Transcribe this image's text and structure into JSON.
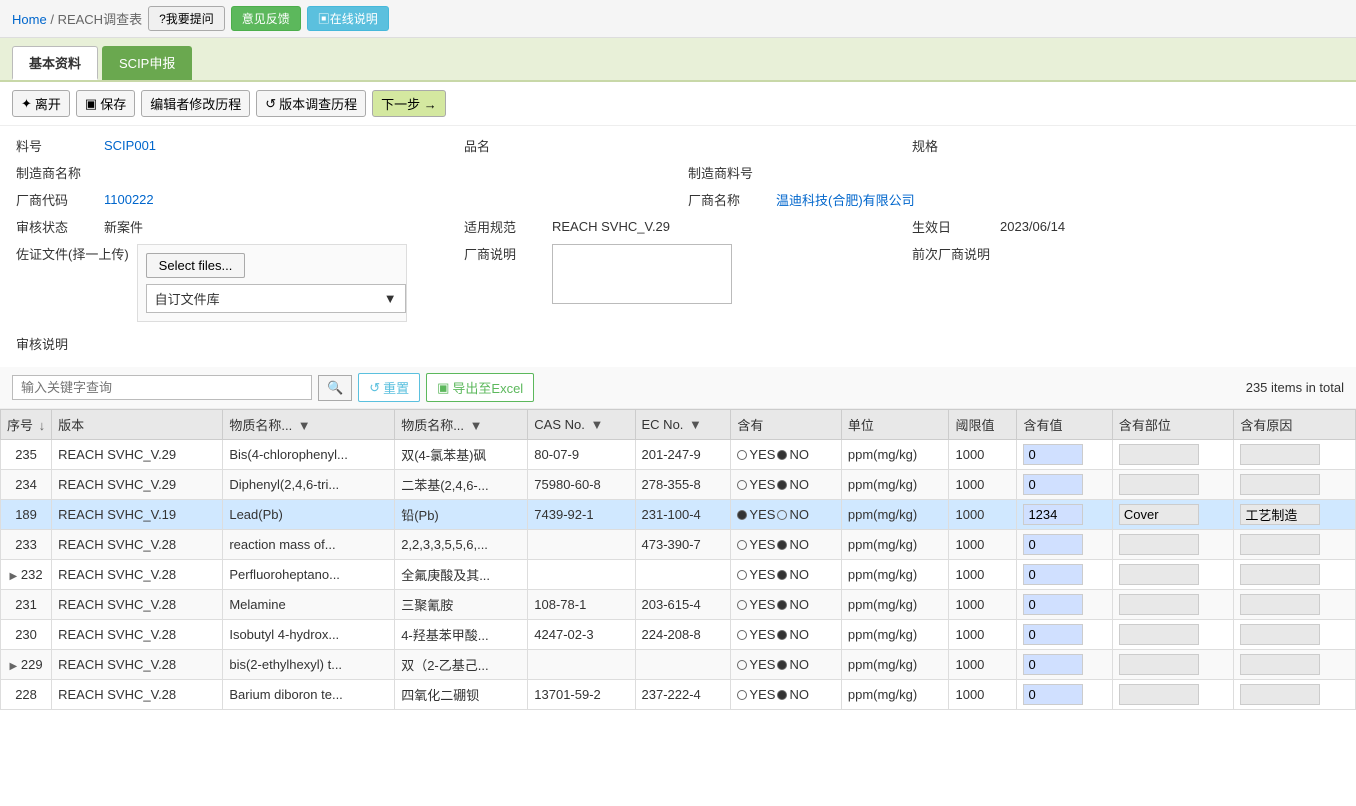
{
  "breadcrumb": {
    "home": "Home",
    "separator": "/",
    "current": "REACH调查表"
  },
  "top_buttons": [
    {
      "label": "?我要提问",
      "type": "default"
    },
    {
      "label": "意见反馈",
      "type": "green"
    },
    {
      "label": "▣在线说明",
      "type": "blue"
    }
  ],
  "tabs": [
    {
      "label": "基本资料",
      "active": true
    },
    {
      "label": "SCIP申报",
      "active": false,
      "style": "scip"
    }
  ],
  "toolbar_buttons": [
    {
      "label": "✦ 离开",
      "icon": "leave-icon"
    },
    {
      "label": "▣ 保存",
      "icon": "save-icon"
    },
    {
      "label": "编辑者修改历程",
      "icon": "edit-history-icon"
    },
    {
      "label": "↺ 版本调查历程",
      "icon": "version-history-icon"
    },
    {
      "label": "下一步 →",
      "icon": "next-icon"
    }
  ],
  "form": {
    "fields": [
      {
        "label": "料号",
        "value": "SCIP001",
        "label2": "品名",
        "value2": "",
        "label3": "规格",
        "value3": ""
      },
      {
        "label": "制造商名称",
        "value": "",
        "label2": "制造商料号",
        "value2": ""
      },
      {
        "label": "厂商代码",
        "value": "1100222",
        "label2": "厂商名称",
        "value2": "温迪科技(合肥)有限公司"
      },
      {
        "label": "审核状态",
        "value": "新案件",
        "label2": "适用规范",
        "value2": "REACH SVHC_V.29",
        "label3": "生效日",
        "value3": "2023/06/14"
      }
    ],
    "file_upload_label": "佐证文件(择一上传)",
    "select_files_btn": "Select files...",
    "file_dropdown_label": "自订文件库",
    "vendor_note_label": "厂商说明",
    "prev_vendor_note_label": "前次厂商说明",
    "review_note_label": "审核说明"
  },
  "search": {
    "placeholder": "输入关键字查询",
    "reset_label": "↺ 重置",
    "export_label": "▣ 导出至Excel",
    "total": "235 items in total"
  },
  "table": {
    "columns": [
      {
        "key": "seq",
        "label": "序号",
        "sortable": true
      },
      {
        "key": "version",
        "label": "版本"
      },
      {
        "key": "substance_en",
        "label": "物质名称...",
        "filterable": true
      },
      {
        "key": "substance_zh",
        "label": "物质名称...",
        "filterable": true
      },
      {
        "key": "cas_no",
        "label": "CAS No.",
        "filterable": true
      },
      {
        "key": "ec_no",
        "label": "EC No.",
        "filterable": true
      },
      {
        "key": "contains",
        "label": "含有"
      },
      {
        "key": "unit",
        "label": "单位"
      },
      {
        "key": "threshold",
        "label": "阈限值"
      },
      {
        "key": "contain_val",
        "label": "含有值"
      },
      {
        "key": "contain_part",
        "label": "含有部位"
      },
      {
        "key": "contain_reason",
        "label": "含有原因"
      }
    ],
    "rows": [
      {
        "expand": false,
        "seq": "235",
        "version": "REACH SVHC_V.29",
        "substance_en": "Bis(4-chlorophenyl...",
        "substance_zh": "双(4-氯苯基)砜",
        "cas_no": "80-07-9",
        "ec_no": "201-247-9",
        "contains_yes": false,
        "contains_no": true,
        "unit": "ppm(mg/kg)",
        "threshold": "1000",
        "contain_val": "0",
        "contain_part": "",
        "contain_reason": "",
        "highlighted": false
      },
      {
        "expand": false,
        "seq": "234",
        "version": "REACH SVHC_V.29",
        "substance_en": "Diphenyl(2,4,6-tri...",
        "substance_zh": "二苯基(2,4,6-...",
        "cas_no": "75980-60-8",
        "ec_no": "278-355-8",
        "contains_yes": false,
        "contains_no": true,
        "unit": "ppm(mg/kg)",
        "threshold": "1000",
        "contain_val": "0",
        "contain_part": "",
        "contain_reason": "",
        "highlighted": false
      },
      {
        "expand": false,
        "seq": "189",
        "version": "REACH SVHC_V.19",
        "substance_en": "Lead(Pb)",
        "substance_zh": "铅(Pb)",
        "cas_no": "7439-92-1",
        "ec_no": "231-100-4",
        "contains_yes": true,
        "contains_no": false,
        "unit": "ppm(mg/kg)",
        "threshold": "1000",
        "contain_val": "1234",
        "contain_part": "Cover",
        "contain_reason": "工艺制造",
        "highlighted": true
      },
      {
        "expand": false,
        "seq": "233",
        "version": "REACH SVHC_V.28",
        "substance_en": "reaction mass of...",
        "substance_zh": "2,2,3,3,5,5,6,...",
        "cas_no": "",
        "ec_no": "473-390-7",
        "contains_yes": false,
        "contains_no": true,
        "unit": "ppm(mg/kg)",
        "threshold": "1000",
        "contain_val": "0",
        "contain_part": "",
        "contain_reason": "",
        "highlighted": false
      },
      {
        "expand": true,
        "seq": "232",
        "version": "REACH SVHC_V.28",
        "substance_en": "Perfluoroheptano...",
        "substance_zh": "全氟庚酸及其...",
        "cas_no": "",
        "ec_no": "",
        "contains_yes": false,
        "contains_no": true,
        "unit": "ppm(mg/kg)",
        "threshold": "1000",
        "contain_val": "0",
        "contain_part": "",
        "contain_reason": "",
        "highlighted": false
      },
      {
        "expand": false,
        "seq": "231",
        "version": "REACH SVHC_V.28",
        "substance_en": "Melamine",
        "substance_zh": "三聚氰胺",
        "cas_no": "108-78-1",
        "ec_no": "203-615-4",
        "contains_yes": false,
        "contains_no": true,
        "unit": "ppm(mg/kg)",
        "threshold": "1000",
        "contain_val": "0",
        "contain_part": "",
        "contain_reason": "",
        "highlighted": false
      },
      {
        "expand": false,
        "seq": "230",
        "version": "REACH SVHC_V.28",
        "substance_en": "Isobutyl 4-hydrox...",
        "substance_zh": "4-羟基苯甲酸...",
        "cas_no": "4247-02-3",
        "ec_no": "224-208-8",
        "contains_yes": false,
        "contains_no": true,
        "unit": "ppm(mg/kg)",
        "threshold": "1000",
        "contain_val": "0",
        "contain_part": "",
        "contain_reason": "",
        "highlighted": false
      },
      {
        "expand": true,
        "seq": "229",
        "version": "REACH SVHC_V.28",
        "substance_en": "bis(2-ethylhexyl) t...",
        "substance_zh": "双（2-乙基己...",
        "cas_no": "",
        "ec_no": "",
        "contains_yes": false,
        "contains_no": true,
        "unit": "ppm(mg/kg)",
        "threshold": "1000",
        "contain_val": "0",
        "contain_part": "",
        "contain_reason": "",
        "highlighted": false
      },
      {
        "expand": false,
        "seq": "228",
        "version": "REACH SVHC_V.28",
        "substance_en": "Barium diboron te...",
        "substance_zh": "四氧化二硼钡",
        "cas_no": "13701-59-2",
        "ec_no": "237-222-4",
        "contains_yes": false,
        "contains_no": true,
        "unit": "ppm(mg/kg)",
        "threshold": "1000",
        "contain_val": "0",
        "contain_part": "",
        "contain_reason": "",
        "highlighted": false
      }
    ]
  },
  "icons": {
    "leave": "✦",
    "save": "▣",
    "history": "📋",
    "version": "↺",
    "next": "→",
    "search": "🔍",
    "reset": "↺",
    "export": "▣",
    "filter": "▼",
    "sort_down": "↓",
    "expand": "▶"
  }
}
